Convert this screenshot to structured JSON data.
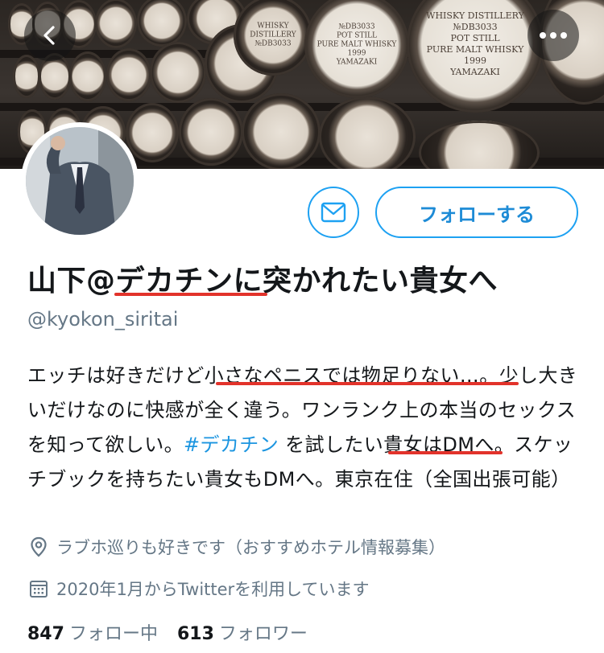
{
  "header": {
    "back_icon": "chevron-left-icon",
    "more_icon": "more-dots-icon",
    "banner_labels": {
      "distillery": "WHISKY DISTILLERY",
      "cask_number": "№DB3033",
      "still": "POT STILL",
      "type": "PURE MALT WHISKY",
      "year": "1999",
      "place": "YAMAZAKI"
    }
  },
  "profile": {
    "name": "山下@デカチンに突かれたい貴女へ",
    "handle": "@kyokon_siritai",
    "bio": {
      "part1": "エッチは好きだけど小さなペニスでは物足りない…。少し大きいだけなのに快感が全く違う。ワンランク上の本当のセックスを知って欲しい。",
      "hashtag": "#デカチン",
      "part2": " を試したい貴女はDMへ。スケッチブックを持ちたい貴女もDMへ。東京在住（全国出張可能）"
    },
    "location": "ラブホ巡りも好きです（おすすめホテル情報募集）",
    "joined": "2020年1月からTwitterを利用しています",
    "following_count": "847",
    "following_label": "フォロー中",
    "followers_count": "613",
    "followers_label": "フォロワー"
  },
  "actions": {
    "message_icon": "envelope-icon",
    "follow_label": "フォローする"
  },
  "colors": {
    "accent": "#1da1f2",
    "link": "#1b95e0",
    "secondary_text": "#657786",
    "annotation_red": "#e2332b"
  }
}
